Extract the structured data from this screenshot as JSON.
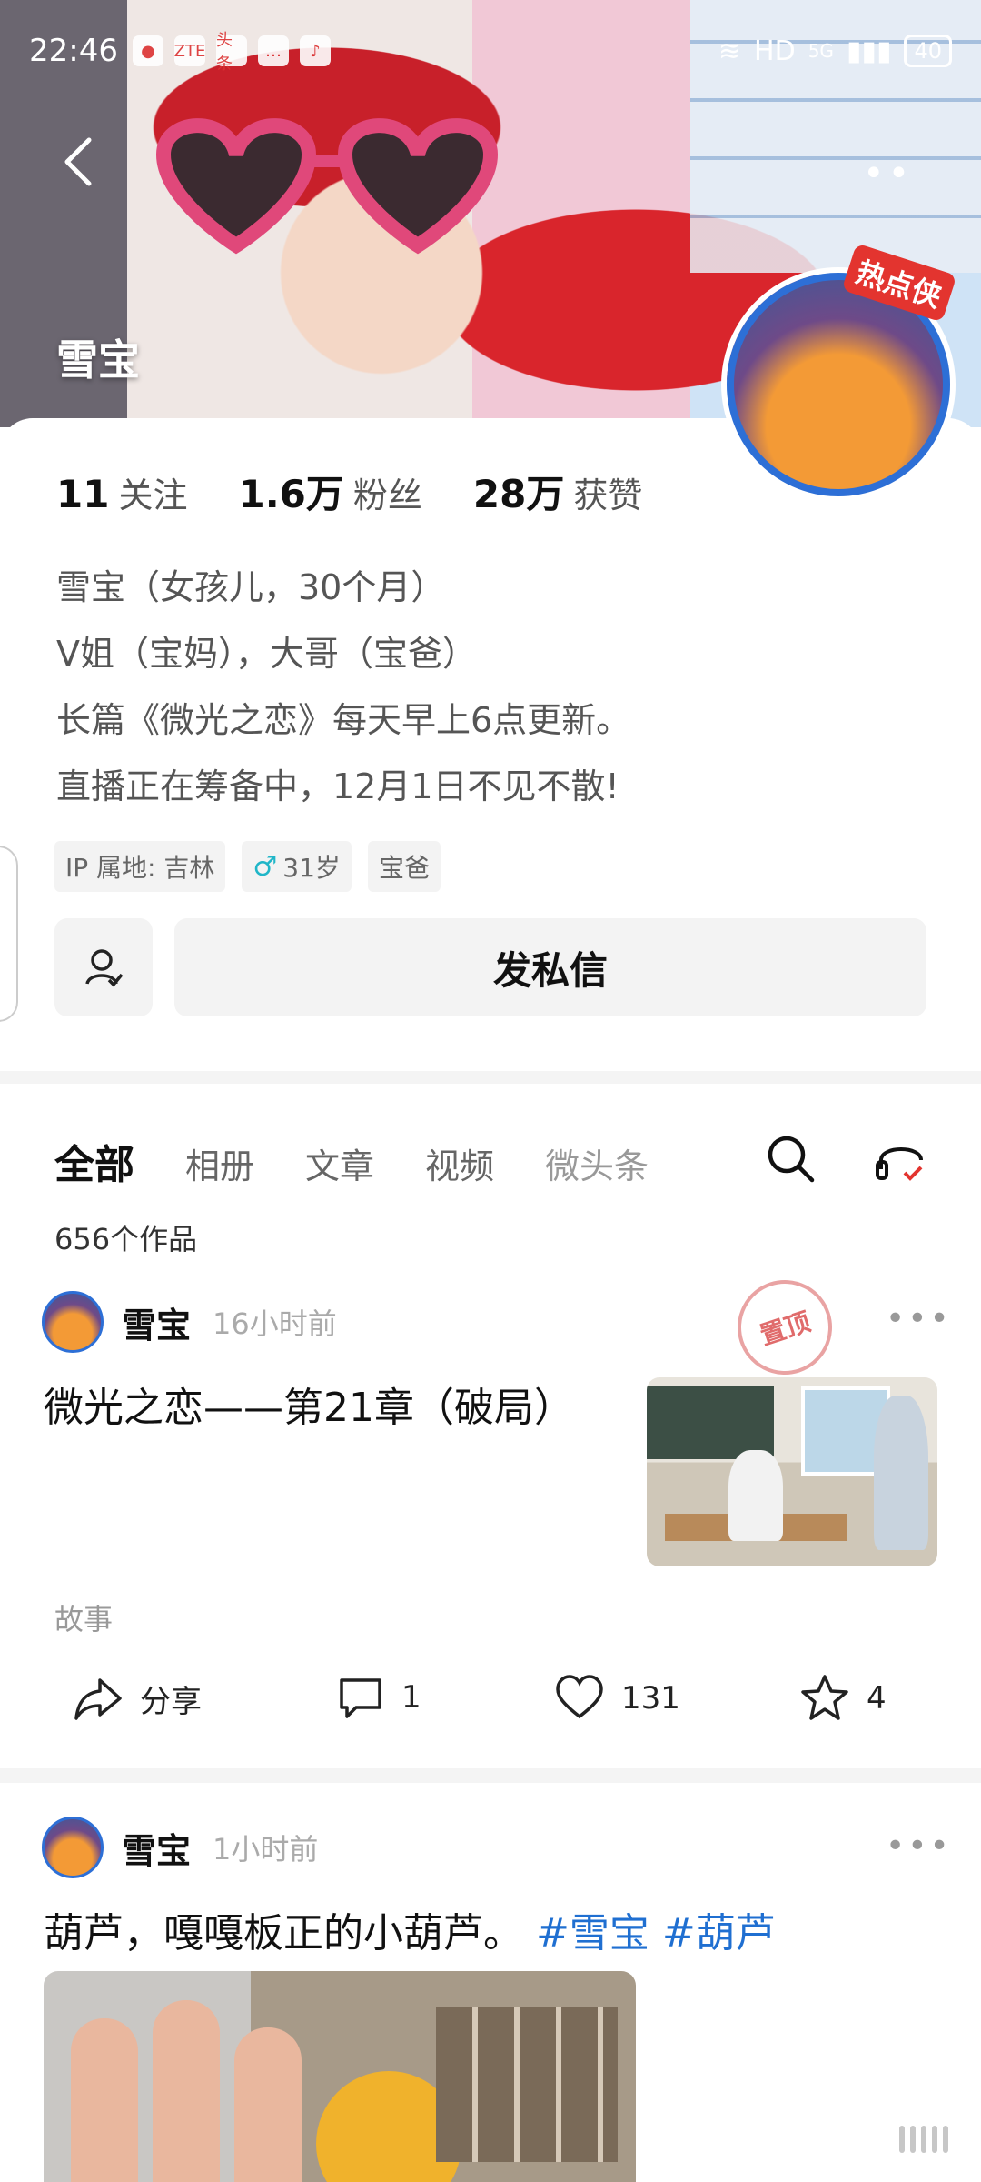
{
  "status_bar": {
    "time": "22:46",
    "app_icons": [
      "app-icon-1",
      "ZTE",
      "头条",
      "chat",
      "music"
    ],
    "network": "HD",
    "signal": "5G",
    "battery": "40"
  },
  "header": {
    "name": "雪宝",
    "badge": "热点侠"
  },
  "stats": [
    {
      "value": "11",
      "label": "关注"
    },
    {
      "value": "1.6万",
      "label": "粉丝"
    },
    {
      "value": "28万",
      "label": "获赞"
    }
  ],
  "bio": [
    "雪宝（女孩儿，30个月）",
    "V姐（宝妈），大哥（宝爸）",
    "长篇《微光之恋》每天早上6点更新。",
    "直播正在筹备中，12月1日不见不散!"
  ],
  "tags": {
    "ip": "IP 属地: 吉林",
    "age": "31岁",
    "role": "宝爸"
  },
  "actions": {
    "message_label": "发私信"
  },
  "tabs": [
    "全部",
    "相册",
    "文章",
    "视频",
    "微头条"
  ],
  "works_count": "656个作品",
  "posts": [
    {
      "author": "雪宝",
      "time": "16小时前",
      "pinned": "置顶",
      "title": "微光之恋——第21章（破局）",
      "category": "故事",
      "share_label": "分享",
      "comments": "1",
      "likes": "131",
      "favorites": "4"
    },
    {
      "author": "雪宝",
      "time": "1小时前",
      "text": "葫芦，嘎嘎板正的小葫芦。",
      "hashtags": [
        "#雪宝",
        "#葫芦"
      ]
    }
  ],
  "colors": {
    "hashtag": "#1f6fd1",
    "badge_ring": "#2d6fd6",
    "badge_label": "#e3342f"
  }
}
